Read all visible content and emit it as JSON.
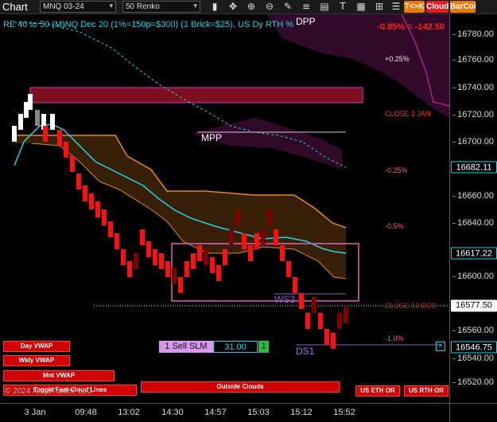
{
  "toolbar": {
    "title": "Chart",
    "instrument": "MNQ 03-24",
    "bar_type": "50 Renko",
    "tkk_label": "T<>K",
    "cloud_label": "Cloud",
    "barcol_label": "BarCol"
  },
  "chart": {
    "header": "RE 40 to 50 (M)NQ Dec 20 (1%=150p=$300) (1 Brick=$25), US Dy RTH %",
    "pnl": "-0.85% = -142.50",
    "labels": {
      "dpp": "DPP",
      "mpp": "MPP",
      "ws3": "WS3",
      "ds1": "DS1",
      "close_2_jan": "CLOSE 2 JAN",
      "close_12_dec": "CLOSE 12 DEC",
      "pct_p025": "+0.25%",
      "pct_m025": "-0.25%",
      "pct_m05": "-0.5%",
      "pct_m1": "-1.0%"
    },
    "copyright": "© 2024 NinjaTrader, LLC",
    "order": {
      "label": "1 Sell SLM",
      "price": "31.00",
      "qty": "1"
    },
    "buttons": {
      "day_vwap": "Day VWAP",
      "wkly_vwap": "Wkly VWAP",
      "mnt_vwap": "Mnt VWAP",
      "toggle_fast_cloud_lines": "Toggle Fast Cloud Lines",
      "outside_clouds": "Outside Clouds",
      "us_eth_or": "US ETH OR",
      "us_rth_or": "US RTH OR"
    }
  },
  "price_axis": {
    "ticks": [
      "16780.00",
      "16760.00",
      "16740.00",
      "16720.00",
      "16700.00",
      "16680.00",
      "16660.00",
      "16640.00",
      "16620.00",
      "16600.00",
      "16580.00",
      "16560.00",
      "16540.00",
      "16520.00"
    ],
    "markers": {
      "current_cyan": "16682.11",
      "current_cyan2": "16617.22",
      "last_white": "16577.50",
      "order_cyan": "16546.75"
    }
  },
  "time_axis": {
    "ticks": [
      "3 Jan",
      "09:48",
      "13:02",
      "14:30",
      "14:57",
      "15:03",
      "15:12",
      "15:52"
    ]
  },
  "colors": {
    "background": "#000000",
    "brick_up": "#ffffff",
    "brick_down": "#ff1010",
    "brick_dark": "#800000",
    "cloud_orange": "#e08a1e",
    "cloud_purple": "#b0208a",
    "vwap_cyan": "#22d3e0"
  }
}
